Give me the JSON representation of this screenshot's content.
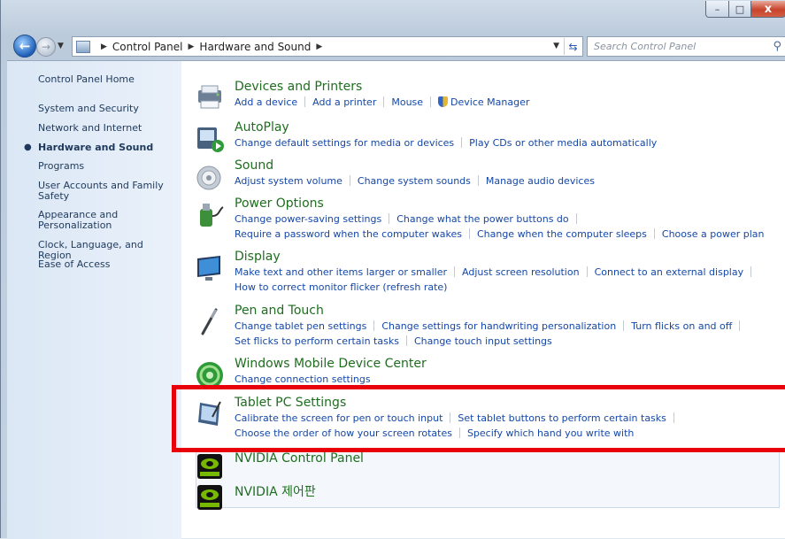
{
  "window": {
    "minimize": "–",
    "maximize": "□",
    "close": "x"
  },
  "nav": {
    "back": "←",
    "forward": "→",
    "crumbs": [
      "Control Panel",
      "Hardware and Sound"
    ],
    "search_placeholder": "Search Control Panel"
  },
  "sidebar": {
    "items": [
      {
        "label": "Control Panel Home",
        "active": false
      },
      {
        "label": "System and Security",
        "active": false
      },
      {
        "label": "Network and Internet",
        "active": false
      },
      {
        "label": "Hardware and Sound",
        "active": true
      },
      {
        "label": "Programs",
        "active": false
      },
      {
        "label": "User Accounts and Family Safety",
        "active": false
      },
      {
        "label": "Appearance and Personalization",
        "active": false
      },
      {
        "label": "Clock, Language, and Region",
        "active": false
      },
      {
        "label": "Ease of Access",
        "active": false
      }
    ]
  },
  "categories": [
    {
      "title": "Devices and Printers",
      "icon": "printer-icon",
      "rows": [
        [
          "Add a device",
          "Add a printer",
          "Mouse",
          "Device Manager"
        ]
      ]
    },
    {
      "title": "AutoPlay",
      "icon": "autoplay-icon",
      "rows": [
        [
          "Change default settings for media or devices",
          "Play CDs or other media automatically"
        ]
      ]
    },
    {
      "title": "Sound",
      "icon": "speaker-icon",
      "rows": [
        [
          "Adjust system volume",
          "Change system sounds",
          "Manage audio devices"
        ]
      ]
    },
    {
      "title": "Power Options",
      "icon": "power-icon",
      "rows": [
        [
          "Change power-saving settings",
          "Change what the power buttons do"
        ],
        [
          "Require a password when the computer wakes",
          "Change when the computer sleeps",
          "Choose a power plan"
        ]
      ]
    },
    {
      "title": "Display",
      "icon": "display-icon",
      "rows": [
        [
          "Make text and other items larger or smaller",
          "Adjust screen resolution",
          "Connect to an external display"
        ],
        [
          "How to correct monitor flicker (refresh rate)"
        ]
      ]
    },
    {
      "title": "Pen and Touch",
      "icon": "pen-icon",
      "rows": [
        [
          "Change tablet pen settings",
          "Change settings for handwriting personalization",
          "Turn flicks on and off"
        ],
        [
          "Set flicks to perform certain tasks",
          "Change touch input settings"
        ]
      ]
    },
    {
      "title": "Windows Mobile Device Center",
      "icon": "sync-icon",
      "rows": [
        [
          "Change connection settings"
        ]
      ]
    },
    {
      "title": "Tablet PC Settings",
      "icon": "tablet-icon",
      "rows": [
        [
          "Calibrate the screen for pen or touch input",
          "Set tablet buttons to perform certain tasks"
        ],
        [
          "Choose the order of how your screen rotates",
          "Specify which hand you write with"
        ]
      ]
    },
    {
      "title": "NVIDIA Control Panel",
      "icon": "nvidia-icon",
      "rows": []
    },
    {
      "title": "NVIDIA 제어판",
      "icon": "nvidia-icon",
      "rows": []
    }
  ]
}
